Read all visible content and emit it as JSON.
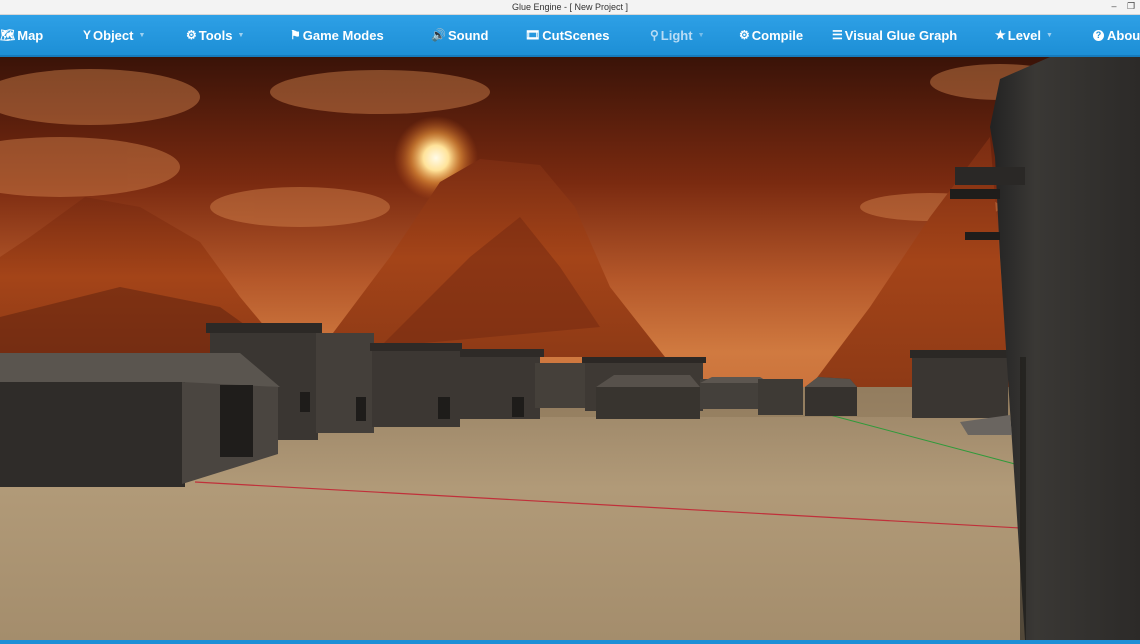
{
  "window": {
    "title": "Glue Engine - [ New Project ]",
    "minimize_glyph": "–",
    "maximize_glyph": "❐"
  },
  "menu": {
    "items": [
      {
        "label": "Map",
        "icon": "map-icon",
        "glyph": "🗺"
      },
      {
        "label": "Object",
        "icon": "funnel-icon",
        "glyph": "Y",
        "has_caret": true
      },
      {
        "label": "Tools",
        "icon": "gears-icon",
        "glyph": "⚙",
        "has_caret": true
      },
      {
        "label": "Game Modes",
        "icon": "flag-icon",
        "glyph": "⚑"
      },
      {
        "label": "Sound",
        "icon": "speaker-icon",
        "glyph": "🔊"
      },
      {
        "label": "CutScenes",
        "icon": "film-icon",
        "glyph": "🎞"
      },
      {
        "label": "Light",
        "icon": "map-marker-icon",
        "glyph": "⚲",
        "has_caret": true,
        "disabled": true
      },
      {
        "label": "Compile",
        "icon": "gear-icon",
        "glyph": "⚙"
      },
      {
        "label": "Visual Glue Graph",
        "icon": "list-icon",
        "glyph": "☰"
      },
      {
        "label": "Level",
        "icon": "star-icon",
        "glyph": "★",
        "has_caret": true
      },
      {
        "label": "About",
        "icon": "question-circle-icon",
        "glyph": "?"
      }
    ],
    "caret_glyph": "▼"
  },
  "colors": {
    "menubar": "#1d8fd6",
    "sky_top": "#3a1308",
    "sky_horizon": "#c26a34",
    "mountain": "#8a3214",
    "ground": "#a89070",
    "building": "#3a3632",
    "x_axis": "#c0303a",
    "z_axis": "#2f9a3a"
  }
}
